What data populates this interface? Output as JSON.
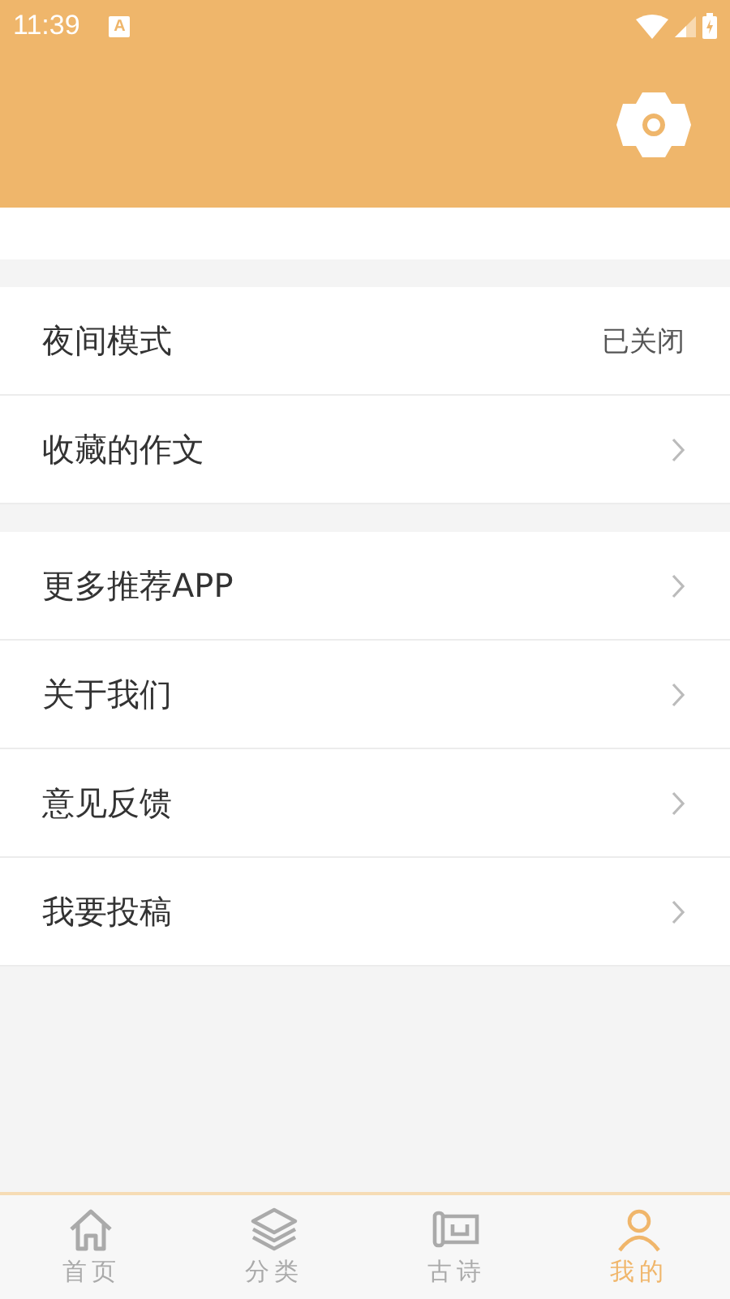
{
  "status_bar": {
    "time": "11:39",
    "notification": "A"
  },
  "sections": [
    {
      "items": [
        {
          "kind": "value",
          "label": "夜间模式",
          "value": "已关闭"
        },
        {
          "kind": "link",
          "label": "收藏的作文"
        }
      ]
    },
    {
      "items": [
        {
          "kind": "link",
          "label": "更多推荐APP"
        },
        {
          "kind": "link",
          "label": "关于我们"
        },
        {
          "kind": "link",
          "label": "意见反馈"
        },
        {
          "kind": "link",
          "label": "我要投稿"
        }
      ]
    }
  ],
  "tabs": [
    {
      "label": "首页",
      "kind": "home",
      "selected": false
    },
    {
      "label": "分类",
      "kind": "layers",
      "selected": false
    },
    {
      "label": "古诗",
      "kind": "scroll",
      "selected": false
    },
    {
      "label": "我的",
      "kind": "person",
      "selected": true
    }
  ]
}
